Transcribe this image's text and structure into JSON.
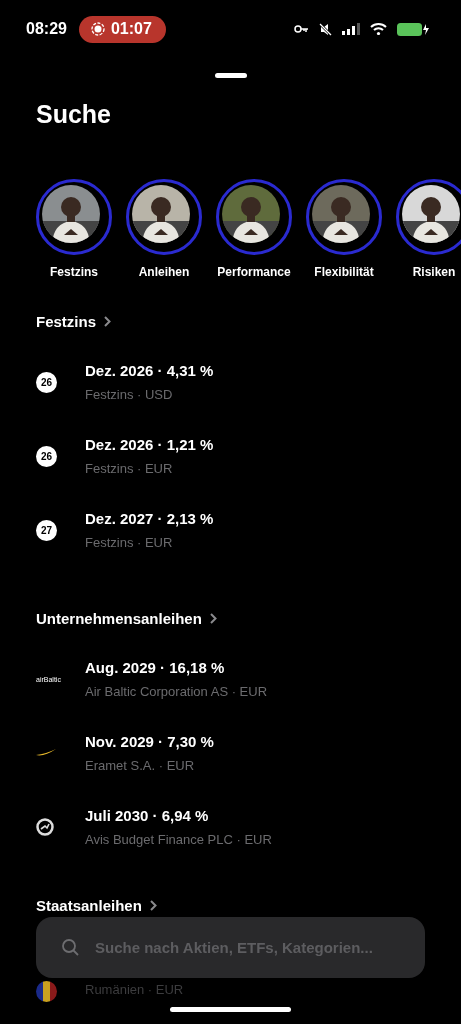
{
  "status_bar": {
    "time": "08:29",
    "recording": "01:07"
  },
  "title": "Suche",
  "stories": [
    {
      "label": "Festzins"
    },
    {
      "label": "Anleihen"
    },
    {
      "label": "Performance"
    },
    {
      "label": "Flexibilität"
    },
    {
      "label": "Risiken"
    }
  ],
  "sections": [
    {
      "title": "Festzins",
      "items": [
        {
          "kind": "badge",
          "badge": "26",
          "title": "Dez. 2026 · 4,31 %",
          "subtitle": "Festzins · USD"
        },
        {
          "kind": "badge",
          "badge": "26",
          "title": "Dez. 2026 · 1,21 %",
          "subtitle": "Festzins · EUR"
        },
        {
          "kind": "badge",
          "badge": "27",
          "title": "Dez. 2027 · 2,13 %",
          "subtitle": "Festzins · EUR"
        }
      ]
    },
    {
      "title": "Unternehmensanleihen",
      "items": [
        {
          "kind": "wordmark",
          "badge": "airBaltic",
          "title": "Aug. 2029 · 16,18 %",
          "subtitle": "Air Baltic Corporation AS · EUR"
        },
        {
          "kind": "swoosh",
          "title": "Nov. 2029 · 7,30 %",
          "subtitle": "Eramet S.A. · EUR"
        },
        {
          "kind": "ring",
          "title": "Juli 2030 · 6,94 %",
          "subtitle": "Avis Budget Finance PLC · EUR"
        }
      ]
    },
    {
      "title": "Staatsanleihen",
      "items": [
        {
          "kind": "flag",
          "subtitle": "Rumänien · EUR"
        }
      ]
    }
  ],
  "search": {
    "placeholder": "Suche nach Aktien, ETFs, Kategorien..."
  }
}
